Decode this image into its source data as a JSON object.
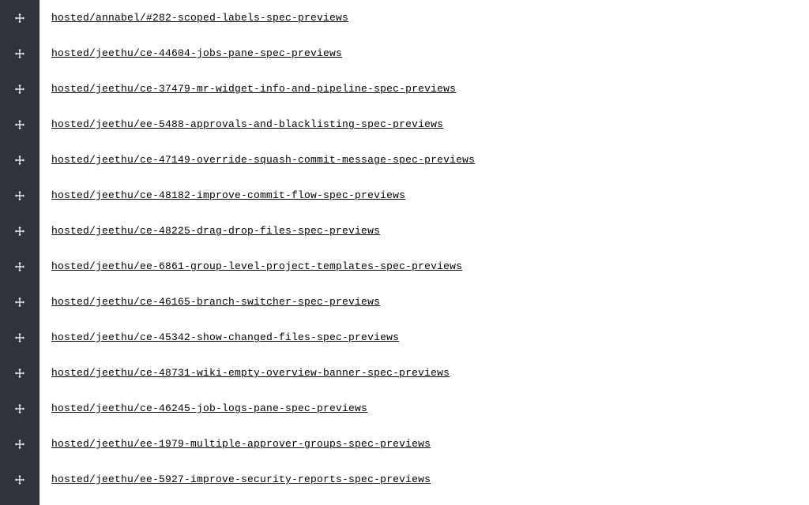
{
  "items": [
    {
      "label": "hosted/annabel/#282-scoped-labels-spec-previews"
    },
    {
      "label": "hosted/jeethu/ce-44604-jobs-pane-spec-previews"
    },
    {
      "label": "hosted/jeethu/ce-37479-mr-widget-info-and-pipeline-spec-previews"
    },
    {
      "label": "hosted/jeethu/ee-5488-approvals-and-blacklisting-spec-previews"
    },
    {
      "label": "hosted/jeethu/ce-47149-override-squash-commit-message-spec-previews"
    },
    {
      "label": "hosted/jeethu/ce-48182-improve-commit-flow-spec-previews"
    },
    {
      "label": "hosted/jeethu/ce-48225-drag-drop-files-spec-previews"
    },
    {
      "label": "hosted/jeethu/ee-6861-group-level-project-templates-spec-previews"
    },
    {
      "label": "hosted/jeethu/ce-46165-branch-switcher-spec-previews"
    },
    {
      "label": "hosted/jeethu/ce-45342-show-changed-files-spec-previews"
    },
    {
      "label": "hosted/jeethu/ce-48731-wiki-empty-overview-banner-spec-previews"
    },
    {
      "label": "hosted/jeethu/ce-46245-job-logs-pane-spec-previews"
    },
    {
      "label": "hosted/jeethu/ee-1979-multiple-approver-groups-spec-previews"
    },
    {
      "label": "hosted/jeethu/ee-5927-improve-security-reports-spec-previews"
    }
  ]
}
